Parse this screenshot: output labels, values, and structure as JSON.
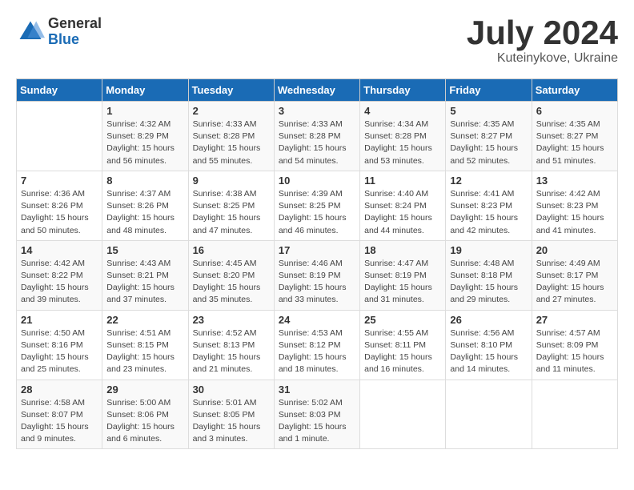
{
  "header": {
    "logo_general": "General",
    "logo_blue": "Blue",
    "month_title": "July 2024",
    "subtitle": "Kuteinykove, Ukraine"
  },
  "columns": [
    "Sunday",
    "Monday",
    "Tuesday",
    "Wednesday",
    "Thursday",
    "Friday",
    "Saturday"
  ],
  "weeks": [
    [
      {
        "day": "",
        "info": ""
      },
      {
        "day": "1",
        "info": "Sunrise: 4:32 AM\nSunset: 8:29 PM\nDaylight: 15 hours\nand 56 minutes."
      },
      {
        "day": "2",
        "info": "Sunrise: 4:33 AM\nSunset: 8:28 PM\nDaylight: 15 hours\nand 55 minutes."
      },
      {
        "day": "3",
        "info": "Sunrise: 4:33 AM\nSunset: 8:28 PM\nDaylight: 15 hours\nand 54 minutes."
      },
      {
        "day": "4",
        "info": "Sunrise: 4:34 AM\nSunset: 8:28 PM\nDaylight: 15 hours\nand 53 minutes."
      },
      {
        "day": "5",
        "info": "Sunrise: 4:35 AM\nSunset: 8:27 PM\nDaylight: 15 hours\nand 52 minutes."
      },
      {
        "day": "6",
        "info": "Sunrise: 4:35 AM\nSunset: 8:27 PM\nDaylight: 15 hours\nand 51 minutes."
      }
    ],
    [
      {
        "day": "7",
        "info": "Sunrise: 4:36 AM\nSunset: 8:26 PM\nDaylight: 15 hours\nand 50 minutes."
      },
      {
        "day": "8",
        "info": "Sunrise: 4:37 AM\nSunset: 8:26 PM\nDaylight: 15 hours\nand 48 minutes."
      },
      {
        "day": "9",
        "info": "Sunrise: 4:38 AM\nSunset: 8:25 PM\nDaylight: 15 hours\nand 47 minutes."
      },
      {
        "day": "10",
        "info": "Sunrise: 4:39 AM\nSunset: 8:25 PM\nDaylight: 15 hours\nand 46 minutes."
      },
      {
        "day": "11",
        "info": "Sunrise: 4:40 AM\nSunset: 8:24 PM\nDaylight: 15 hours\nand 44 minutes."
      },
      {
        "day": "12",
        "info": "Sunrise: 4:41 AM\nSunset: 8:23 PM\nDaylight: 15 hours\nand 42 minutes."
      },
      {
        "day": "13",
        "info": "Sunrise: 4:42 AM\nSunset: 8:23 PM\nDaylight: 15 hours\nand 41 minutes."
      }
    ],
    [
      {
        "day": "14",
        "info": "Sunrise: 4:42 AM\nSunset: 8:22 PM\nDaylight: 15 hours\nand 39 minutes."
      },
      {
        "day": "15",
        "info": "Sunrise: 4:43 AM\nSunset: 8:21 PM\nDaylight: 15 hours\nand 37 minutes."
      },
      {
        "day": "16",
        "info": "Sunrise: 4:45 AM\nSunset: 8:20 PM\nDaylight: 15 hours\nand 35 minutes."
      },
      {
        "day": "17",
        "info": "Sunrise: 4:46 AM\nSunset: 8:19 PM\nDaylight: 15 hours\nand 33 minutes."
      },
      {
        "day": "18",
        "info": "Sunrise: 4:47 AM\nSunset: 8:19 PM\nDaylight: 15 hours\nand 31 minutes."
      },
      {
        "day": "19",
        "info": "Sunrise: 4:48 AM\nSunset: 8:18 PM\nDaylight: 15 hours\nand 29 minutes."
      },
      {
        "day": "20",
        "info": "Sunrise: 4:49 AM\nSunset: 8:17 PM\nDaylight: 15 hours\nand 27 minutes."
      }
    ],
    [
      {
        "day": "21",
        "info": "Sunrise: 4:50 AM\nSunset: 8:16 PM\nDaylight: 15 hours\nand 25 minutes."
      },
      {
        "day": "22",
        "info": "Sunrise: 4:51 AM\nSunset: 8:15 PM\nDaylight: 15 hours\nand 23 minutes."
      },
      {
        "day": "23",
        "info": "Sunrise: 4:52 AM\nSunset: 8:13 PM\nDaylight: 15 hours\nand 21 minutes."
      },
      {
        "day": "24",
        "info": "Sunrise: 4:53 AM\nSunset: 8:12 PM\nDaylight: 15 hours\nand 18 minutes."
      },
      {
        "day": "25",
        "info": "Sunrise: 4:55 AM\nSunset: 8:11 PM\nDaylight: 15 hours\nand 16 minutes."
      },
      {
        "day": "26",
        "info": "Sunrise: 4:56 AM\nSunset: 8:10 PM\nDaylight: 15 hours\nand 14 minutes."
      },
      {
        "day": "27",
        "info": "Sunrise: 4:57 AM\nSunset: 8:09 PM\nDaylight: 15 hours\nand 11 minutes."
      }
    ],
    [
      {
        "day": "28",
        "info": "Sunrise: 4:58 AM\nSunset: 8:07 PM\nDaylight: 15 hours\nand 9 minutes."
      },
      {
        "day": "29",
        "info": "Sunrise: 5:00 AM\nSunset: 8:06 PM\nDaylight: 15 hours\nand 6 minutes."
      },
      {
        "day": "30",
        "info": "Sunrise: 5:01 AM\nSunset: 8:05 PM\nDaylight: 15 hours\nand 3 minutes."
      },
      {
        "day": "31",
        "info": "Sunrise: 5:02 AM\nSunset: 8:03 PM\nDaylight: 15 hours\nand 1 minute."
      },
      {
        "day": "",
        "info": ""
      },
      {
        "day": "",
        "info": ""
      },
      {
        "day": "",
        "info": ""
      }
    ]
  ]
}
